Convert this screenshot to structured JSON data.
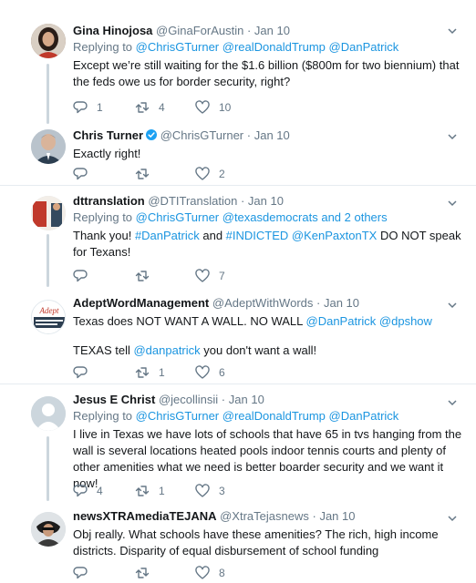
{
  "tweets": [
    {
      "name": "Gina Hinojosa",
      "handle": "@GinaForAustin",
      "date": "Jan 10",
      "verified": false,
      "reply_prefix": "Replying to",
      "reply_mentions": [
        "@ChrisGTurner",
        "@realDonaldTrump",
        "@DanPatrick"
      ],
      "reply_suffix": "",
      "text_segments": [
        [
          {
            "t": "Except we’re still waiting for the $1.6 billion ($800m for two biennium) that the feds owe us for border security, right?",
            "m": false
          }
        ]
      ],
      "replies": "1",
      "retweets": "4",
      "likes": "10"
    },
    {
      "name": "Chris Turner",
      "handle": "@ChrisGTurner",
      "date": "Jan 10",
      "verified": true,
      "text_segments": [
        [
          {
            "t": "Exactly right!",
            "m": false
          }
        ]
      ],
      "replies": "",
      "retweets": "",
      "likes": "2"
    },
    {
      "name": "dttranslation",
      "handle": "@DTITranslation",
      "date": "Jan 10",
      "verified": false,
      "reply_prefix": "Replying to",
      "reply_mentions": [
        "@ChrisGTurner",
        "@texasdemocrats"
      ],
      "reply_suffix": "and 2 others",
      "text_segments": [
        [
          {
            "t": "Thank you! ",
            "m": false
          },
          {
            "t": "#DanPatrick",
            "m": true
          },
          {
            "t": " and ",
            "m": false
          },
          {
            "t": "#INDICTED",
            "m": true
          },
          {
            "t": " ",
            "m": false
          },
          {
            "t": "@KenPaxtonTX",
            "m": true
          },
          {
            "t": " DO NOT speak for Texans!",
            "m": false
          }
        ]
      ],
      "replies": "",
      "retweets": "",
      "likes": "7"
    },
    {
      "name": "AdeptWordManagement",
      "handle": "@AdeptWithWords",
      "date": "Jan 10",
      "verified": false,
      "text_segments": [
        [
          {
            "t": "Texas does NOT WANT A WALL. NO WALL ",
            "m": false
          },
          {
            "t": "@DanPatrick",
            "m": true
          },
          {
            "t": " ",
            "m": false
          },
          {
            "t": "@dpshow",
            "m": true
          }
        ],
        [
          {
            "t": "TEXAS tell ",
            "m": false
          },
          {
            "t": "@danpatrick",
            "m": true
          },
          {
            "t": " you don't want a wall!",
            "m": false
          }
        ]
      ],
      "replies": "",
      "retweets": "1",
      "likes": "6"
    },
    {
      "name": "Jesus E Christ",
      "handle": "@jecollinsii",
      "date": "Jan 10",
      "verified": false,
      "reply_prefix": "Replying to",
      "reply_mentions": [
        "@ChrisGTurner",
        "@realDonaldTrump",
        "@DanPatrick"
      ],
      "reply_suffix": "",
      "text_segments": [
        [
          {
            "t": "I live in Texas we have lots of schools that have 65 in tvs hanging from the wall is several locations heated pools indoor tennis courts and plenty of other amenities what we need is better boarder security and we want it now!",
            "m": false
          }
        ]
      ],
      "replies": "4",
      "retweets": "1",
      "likes": "3"
    },
    {
      "name": "newsXTRAmediaTEJANA",
      "handle": "@XtraTejasnews",
      "date": "Jan 10",
      "verified": false,
      "text_segments": [
        [
          {
            "t": "Obj really. What schools have these amenities? The rich, high income districts. Disparity of equal disbursement of school funding",
            "m": false
          }
        ]
      ],
      "replies": "",
      "retweets": "",
      "likes": "8"
    }
  ],
  "colors": {
    "link": "#1b95e0",
    "muted": "#657786",
    "thread_line": "#ccd6dd",
    "verified": "#1da1f2"
  },
  "icons": [
    "reply-icon",
    "retweet-icon",
    "like-icon",
    "chevron-down-icon",
    "verified-badge-icon"
  ]
}
